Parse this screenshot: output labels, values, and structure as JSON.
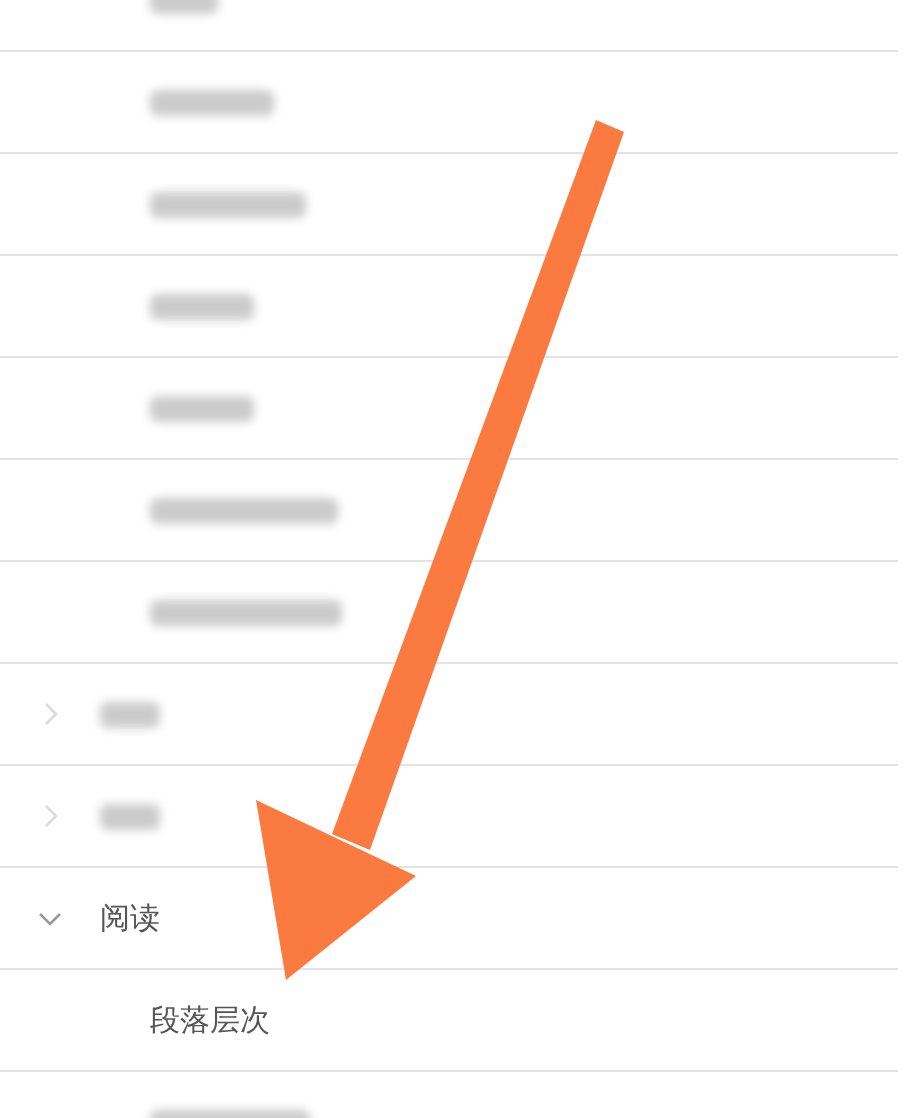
{
  "top_items": [
    {
      "kind": "blurred"
    },
    {
      "kind": "blurred"
    },
    {
      "kind": "blurred"
    },
    {
      "kind": "blurred"
    },
    {
      "kind": "blurred"
    },
    {
      "kind": "blurred"
    },
    {
      "kind": "blurred"
    }
  ],
  "sections": [
    {
      "kind": "blurred",
      "expanded": false
    },
    {
      "kind": "blurred",
      "expanded": false
    },
    {
      "kind": "text",
      "label": "阅读",
      "expanded": true,
      "children": [
        {
          "kind": "text",
          "label": "段落层次"
        },
        {
          "kind": "blurred"
        }
      ]
    }
  ]
}
